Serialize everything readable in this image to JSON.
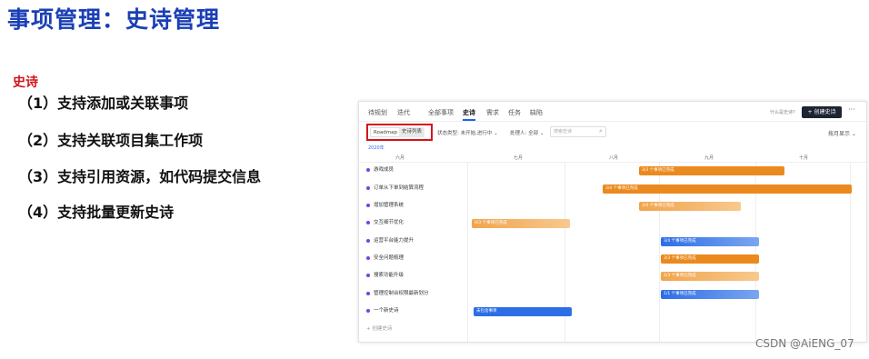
{
  "slide": {
    "title": "事项管理：史诗管理",
    "section": "史诗",
    "bullets": [
      "（1）支持添加或关联事项",
      "（2）支持关联项目集工作项",
      "（3）支持引用资源，如代码提交信息",
      "（4）支持批量更新史诗"
    ]
  },
  "app": {
    "nav": [
      "待规划",
      "迭代",
      "全部事项",
      "史诗",
      "需求",
      "任务",
      "缺陷"
    ],
    "active_tab": "史诗",
    "help_link": "什么是史诗?",
    "create_button": "+ 创建史诗",
    "more": "···",
    "view_toggle": [
      "Roadmap",
      "史诗列表"
    ],
    "filters": [
      "状态类型: 未开始,进行中 ⌄",
      "处理人: 全部 ⌄"
    ],
    "search_placeholder": "搜索史诗",
    "sort": "按月显示 ⌄",
    "year": "2020年",
    "months": [
      "六月",
      "七月",
      "八月",
      "九月",
      "十月"
    ],
    "epics": [
      "游戏成员",
      "订单从下单到结算流程",
      "增加管理系统",
      "交互细节优化",
      "运营平台能力提升",
      "安全问题梳理",
      "搜索功能升级",
      "管理控制台权限最新划分",
      "一个新史诗"
    ],
    "add_epic": "+ 创建史诗",
    "bars": [
      "3/3 个事项已完成",
      "3/4 个事项已完成",
      "3/4 个事项已完成",
      "0/3 个事项已完成",
      "3/4 个事项已完成",
      "3/3 个事项已完成",
      "2/3 个事项已完成",
      "1/1 个事项已完成",
      "未包含事项"
    ]
  },
  "watermark": "CSDN @AiENG_07",
  "colors": {
    "title": "#1a3fb5",
    "accent_red": "#d4141a",
    "bar_orange": "#ea8a1e",
    "bar_blue": "#2d6ee6"
  }
}
